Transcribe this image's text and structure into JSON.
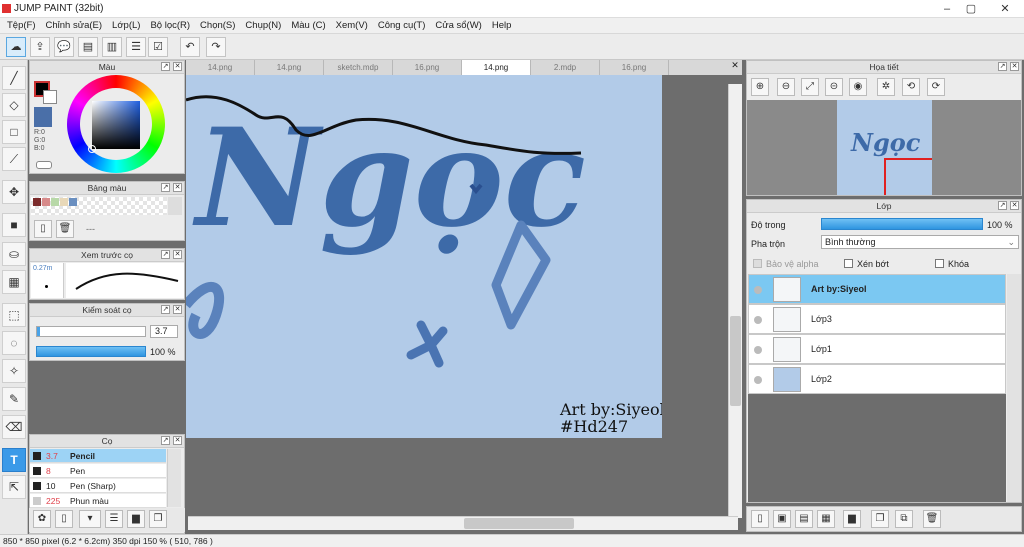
{
  "app": {
    "title": "JUMP PAINT (32bit)"
  },
  "menu": [
    "Tệp(F)",
    "Chỉnh sửa(E)",
    "Lớp(L)",
    "Bộ lọc(R)",
    "Chọn(S)",
    "Chụp(N)",
    "Màu (C)",
    "Xem(V)",
    "Công cụ(T)",
    "Cửa sổ(W)",
    "Help"
  ],
  "tabs": [
    "14.png",
    "14.png",
    "sketch.mdp",
    "16.png",
    "14.png",
    "2.mdp",
    "16.png"
  ],
  "active_tab_index": 4,
  "color_panel": {
    "title": "Màu",
    "rgb": [
      "R:0",
      "G:0",
      "B:0"
    ]
  },
  "palette_panel": {
    "title": "Bảng màu",
    "more": "---",
    "swatches": [
      "#7a2a2a",
      "#d78a8a",
      "#b8d8a8",
      "#e8d8b8",
      "#6a8fc0"
    ]
  },
  "brush_preview": {
    "title": "Xem trước cọ",
    "size": "0.27m"
  },
  "brush_control": {
    "title": "Kiểm soát cọ",
    "size_value": "3.7",
    "opacity_value": "100 %"
  },
  "brush_panel": {
    "title": "Cọ",
    "items": [
      {
        "size": "3.7",
        "name": "Pencil",
        "selected": true,
        "swatch": "#222222"
      },
      {
        "size": "8",
        "name": "Pen",
        "selected": false,
        "swatch": "#222222"
      },
      {
        "size": "10",
        "name": "Pen (Sharp)",
        "selected": false,
        "swatch": "#222222"
      },
      {
        "size": "225",
        "name": "Phun màu",
        "selected": false,
        "swatch": "#cccccc"
      }
    ]
  },
  "artwork": {
    "big_text": "Ngọc",
    "thumb_text": "Ngọc",
    "credit1": "Art by:Siyeol",
    "credit2": "#Hd247"
  },
  "navigator": {
    "title": "Họa tiết"
  },
  "layer_panel": {
    "title": "Lớp",
    "opacity_label": "Độ trong",
    "opacity_value": "100 %",
    "opacity_fraction": 1.0,
    "blend_label": "Pha trộn",
    "blend_value": "Bình thường",
    "protect_alpha": "Bảo vệ alpha",
    "clip": "Xén bớt",
    "lock": "Khóa",
    "layers": [
      {
        "name": "Art by:Siyeol",
        "selected": true
      },
      {
        "name": "Lớp3",
        "selected": false
      },
      {
        "name": "Lớp1",
        "selected": false
      },
      {
        "name": "Lớp2",
        "selected": false
      }
    ]
  },
  "status": "850 * 850 pixel   (6.2 * 6.2cm)   350 dpi   150 %   ( 510, 786 )",
  "colors": {
    "accent": "#3b9ae8",
    "layer_selected": "#7bc8f2",
    "canvas_bg": "#b2cbe8",
    "lettering": "#3d6aa8"
  }
}
